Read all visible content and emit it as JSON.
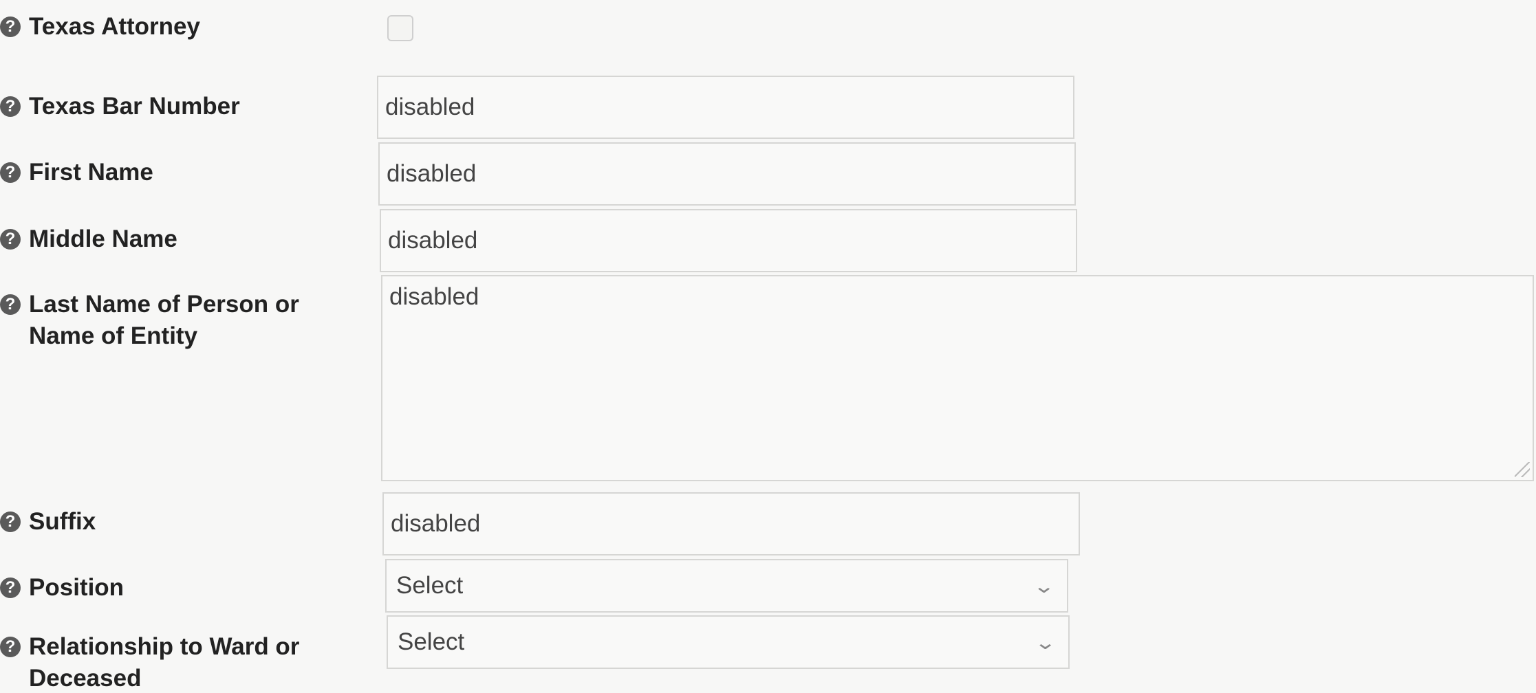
{
  "fields": {
    "texas_attorney": {
      "label": "Texas Attorney",
      "checked": false
    },
    "texas_bar_number": {
      "label": "Texas Bar Number",
      "value": "disabled"
    },
    "first_name": {
      "label": "First Name",
      "value": "disabled"
    },
    "middle_name": {
      "label": "Middle Name",
      "value": "disabled"
    },
    "last_name": {
      "label": "Last Name of Person or Name of Entity",
      "value": "disabled"
    },
    "suffix": {
      "label": "Suffix",
      "value": "disabled"
    },
    "position": {
      "label": "Position",
      "selected": "Select"
    },
    "relationship": {
      "label": "Relationship to Ward or Deceased",
      "selected": "Select"
    }
  },
  "icons": {
    "help": "help-circle-icon",
    "dropdown": "chevron-down-icon"
  }
}
